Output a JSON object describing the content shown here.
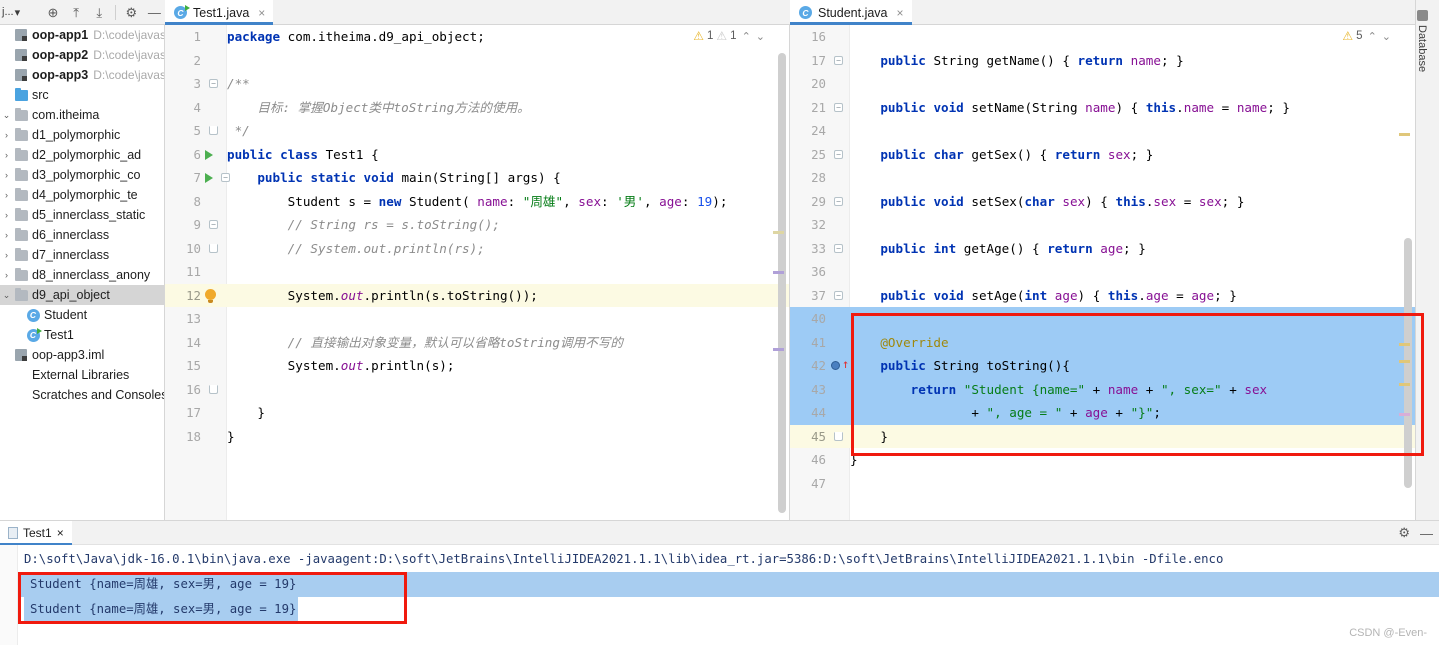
{
  "toolbar": {
    "project_selector": "j...",
    "buttons": [
      {
        "name": "locate-icon",
        "glyph": "⊕"
      },
      {
        "name": "expand-all-icon",
        "glyph": "⤒"
      },
      {
        "name": "collapse-all-icon",
        "glyph": "⤓"
      },
      {
        "name": "settings-icon",
        "glyph": "⚙"
      },
      {
        "name": "hide-icon",
        "glyph": "—"
      }
    ]
  },
  "project_tree": [
    {
      "label": "oop-app1",
      "path": "D:\\code\\javasepro",
      "bold": true,
      "icon": "module-icon",
      "depth": 0,
      "arrow": "",
      "selected": false
    },
    {
      "label": "oop-app2",
      "path": "D:\\code\\javasepro",
      "bold": true,
      "icon": "module-icon",
      "depth": 0,
      "arrow": "",
      "selected": false
    },
    {
      "label": "oop-app3",
      "path": "D:\\code\\javasepro",
      "bold": true,
      "icon": "module-icon",
      "depth": 0,
      "arrow": "",
      "selected": false
    },
    {
      "label": "src",
      "path": "",
      "bold": false,
      "icon": "source-folder-icon",
      "depth": 0,
      "arrow": "",
      "selected": false
    },
    {
      "label": "com.itheima",
      "path": "",
      "bold": false,
      "icon": "package-icon",
      "depth": 0,
      "arrow": "v",
      "selected": false
    },
    {
      "label": "d1_polymorphic",
      "path": "",
      "bold": false,
      "icon": "package-icon",
      "depth": 1,
      "arrow": ">",
      "selected": false
    },
    {
      "label": "d2_polymorphic_ad",
      "path": "",
      "bold": false,
      "icon": "package-icon",
      "depth": 1,
      "arrow": ">",
      "selected": false
    },
    {
      "label": "d3_polymorphic_co",
      "path": "",
      "bold": false,
      "icon": "package-icon",
      "depth": 1,
      "arrow": ">",
      "selected": false
    },
    {
      "label": "d4_polymorphic_te",
      "path": "",
      "bold": false,
      "icon": "package-icon",
      "depth": 1,
      "arrow": ">",
      "selected": false
    },
    {
      "label": "d5_innerclass_static",
      "path": "",
      "bold": false,
      "icon": "package-icon",
      "depth": 1,
      "arrow": ">",
      "selected": false
    },
    {
      "label": "d6_innerclass",
      "path": "",
      "bold": false,
      "icon": "package-icon",
      "depth": 1,
      "arrow": ">",
      "selected": false
    },
    {
      "label": "d7_innerclass",
      "path": "",
      "bold": false,
      "icon": "package-icon",
      "depth": 1,
      "arrow": ">",
      "selected": false
    },
    {
      "label": "d8_innerclass_anony",
      "path": "",
      "bold": false,
      "icon": "package-icon",
      "depth": 1,
      "arrow": ">",
      "selected": false
    },
    {
      "label": "d9_api_object",
      "path": "",
      "bold": false,
      "icon": "package-icon",
      "depth": 1,
      "arrow": "v",
      "selected": true
    },
    {
      "label": "Student",
      "path": "",
      "bold": false,
      "icon": "java-class-icon",
      "depth": 2,
      "arrow": "",
      "selected": false
    },
    {
      "label": "Test1",
      "path": "",
      "bold": false,
      "icon": "java-runnable-class-icon",
      "depth": 2,
      "arrow": "",
      "selected": false
    },
    {
      "label": "oop-app3.iml",
      "path": "",
      "bold": false,
      "icon": "iml-file-icon",
      "depth": 0,
      "arrow": "",
      "selected": false
    },
    {
      "label": "External Libraries",
      "path": "",
      "bold": false,
      "icon": "libraries-icon",
      "depth": 0,
      "arrow": "",
      "selected": false
    },
    {
      "label": "Scratches and Consoles",
      "path": "",
      "bold": false,
      "icon": "scratches-icon",
      "depth": 0,
      "arrow": "",
      "selected": false
    }
  ],
  "editor_left": {
    "tab": {
      "label": "Test1.java",
      "close": "×",
      "icon": "java-runnable-class-icon"
    },
    "inspections": {
      "warning_count": "1",
      "weak_warning_count": "1",
      "up": "⌃",
      "down": "⌄"
    },
    "lines": [
      {
        "num": "1",
        "gutter": "",
        "highlight": ""
      },
      {
        "num": "2",
        "gutter": "",
        "highlight": ""
      },
      {
        "num": "3",
        "gutter": "fold-open",
        "highlight": ""
      },
      {
        "num": "4",
        "gutter": "",
        "highlight": ""
      },
      {
        "num": "5",
        "gutter": "fold-end",
        "highlight": ""
      },
      {
        "num": "6",
        "gutter": "run-arrow",
        "highlight": ""
      },
      {
        "num": "7",
        "gutter": "run-arrow-fold",
        "highlight": ""
      },
      {
        "num": "8",
        "gutter": "",
        "highlight": ""
      },
      {
        "num": "9",
        "gutter": "fold-open",
        "highlight": ""
      },
      {
        "num": "10",
        "gutter": "fold-end",
        "highlight": ""
      },
      {
        "num": "11",
        "gutter": "",
        "highlight": ""
      },
      {
        "num": "12",
        "gutter": "bulb",
        "highlight": "hl-yellow"
      },
      {
        "num": "13",
        "gutter": "",
        "highlight": ""
      },
      {
        "num": "14",
        "gutter": "",
        "highlight": ""
      },
      {
        "num": "15",
        "gutter": "",
        "highlight": ""
      },
      {
        "num": "16",
        "gutter": "fold-end",
        "highlight": ""
      },
      {
        "num": "17",
        "gutter": "",
        "highlight": ""
      },
      {
        "num": "18",
        "gutter": "",
        "highlight": ""
      }
    ],
    "code_text": [
      "package com.itheima.d9_api_object;",
      "",
      "/**",
      "    目标: 掌握Object类中toString方法的使用。",
      " */",
      "public class Test1 {",
      "    public static void main(String[] args) {",
      "        Student s = new Student( name: \"周雄\", sex: '男', age: 19);",
      "        // String rs = s.toString();",
      "        // System.out.println(rs);",
      "",
      "        System.out.println(s.toString());",
      "",
      "        // 直接输出对象变量，默认可以省略toString调用不写的",
      "        System.out.println(s);",
      "",
      "    }",
      "}",
      ""
    ]
  },
  "editor_right": {
    "tab": {
      "label": "Student.java",
      "close": "×",
      "icon": "java-class-icon"
    },
    "inspections": {
      "warning_count": "5",
      "up": "⌃",
      "down": "⌄"
    },
    "lines": [
      {
        "num": "16",
        "gutter": "",
        "highlight": ""
      },
      {
        "num": "17",
        "gutter": "fold",
        "highlight": ""
      },
      {
        "num": "20",
        "gutter": "",
        "highlight": ""
      },
      {
        "num": "21",
        "gutter": "fold",
        "highlight": ""
      },
      {
        "num": "24",
        "gutter": "",
        "highlight": ""
      },
      {
        "num": "25",
        "gutter": "fold",
        "highlight": ""
      },
      {
        "num": "28",
        "gutter": "",
        "highlight": ""
      },
      {
        "num": "29",
        "gutter": "fold",
        "highlight": ""
      },
      {
        "num": "32",
        "gutter": "",
        "highlight": ""
      },
      {
        "num": "33",
        "gutter": "fold",
        "highlight": ""
      },
      {
        "num": "36",
        "gutter": "",
        "highlight": ""
      },
      {
        "num": "37",
        "gutter": "fold",
        "highlight": ""
      },
      {
        "num": "40",
        "gutter": "",
        "highlight": "hl-blue"
      },
      {
        "num": "41",
        "gutter": "",
        "highlight": "hl-blue"
      },
      {
        "num": "42",
        "gutter": "breakpoint",
        "highlight": "hl-blue"
      },
      {
        "num": "43",
        "gutter": "",
        "highlight": "hl-blue"
      },
      {
        "num": "44",
        "gutter": "",
        "highlight": "hl-blue"
      },
      {
        "num": "45",
        "gutter": "fold-end",
        "highlight": "hl-yellow"
      },
      {
        "num": "46",
        "gutter": "",
        "highlight": ""
      },
      {
        "num": "47",
        "gutter": "",
        "highlight": ""
      }
    ],
    "code_text": [
      "",
      "    public String getName() { return name; }",
      "",
      "    public void setName(String name) { this.name = name; }",
      "",
      "    public char getSex() { return sex; }",
      "",
      "    public void setSex(char sex) { this.sex = sex; }",
      "",
      "    public int getAge() { return age; }",
      "",
      "    public void setAge(int age) { this.age = age; }",
      "",
      "    @Override",
      "    public String toString(){",
      "        return \"Student {name=\" + name + \", sex=\" + sex",
      "                + \", age = \" + age + \"}\";",
      "    }",
      "}",
      ""
    ]
  },
  "right_rail": {
    "items": [
      {
        "label": "Database",
        "icon": "database-icon"
      }
    ]
  },
  "run_panel": {
    "tab": {
      "label": "Test1",
      "close": "×",
      "icon": "console-icon"
    },
    "actions": [
      {
        "name": "settings-icon",
        "glyph": "⚙"
      },
      {
        "name": "hide-icon",
        "glyph": "—"
      }
    ],
    "console_lines": [
      {
        "text": "D:\\soft\\Java\\jdk-16.0.1\\bin\\java.exe -javaagent:D:\\soft\\JetBrains\\IntelliJIDEA2021.1.1\\lib\\idea_rt.jar=5386:D:\\soft\\JetBrains\\IntelliJIDEA2021.1.1\\bin -Dfile.enco",
        "selected": false
      },
      {
        "text": "Student {name=周雄, sex=男, age = 19}",
        "selected": true
      },
      {
        "text": "Student {name=周雄, sex=男, age = 19}",
        "selected": true
      }
    ]
  },
  "watermark": "CSDN @-Even-",
  "colors": {
    "accent_tab_underline": "#4083c9",
    "selection_blue": "#9dcbf5",
    "console_selection": "#a8cdf0",
    "current_line_yellow": "#fcfae3",
    "annotation_red": "#f01a0e",
    "warning_yellow": "#e8b62c",
    "tree_selected_grey": "#d5d5d5"
  }
}
